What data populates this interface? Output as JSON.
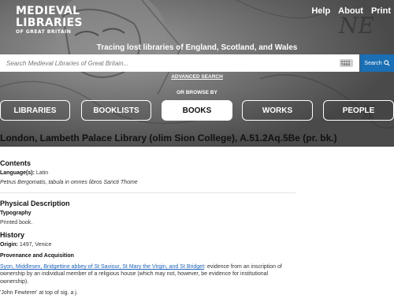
{
  "header": {
    "logo_line1": "MEDIEVAL",
    "logo_line2": "LIBRARIES",
    "logo_line3": "OF GREAT BRITAIN",
    "nav": [
      "Help",
      "About",
      "Print"
    ],
    "tagline": "Tracing lost libraries of England, Scotland, and Wales"
  },
  "search": {
    "placeholder": "Search Medieval Libraries of Great Britain...",
    "button_label": "Search",
    "advanced_label": "ADVANCED SEARCH",
    "browse_label": "OR BROWSE BY"
  },
  "browse": [
    {
      "label": "LIBRARIES",
      "active": false
    },
    {
      "label": "BOOKLISTS",
      "active": false
    },
    {
      "label": "BOOKS",
      "active": true
    },
    {
      "label": "WORKS",
      "active": false
    },
    {
      "label": "PEOPLE",
      "active": false
    }
  ],
  "record": {
    "title": "London, Lambeth Palace Library (olim Sion College), A.51.2Aq.5Be (pr. bk.)",
    "contents_heading": "Contents",
    "language_label": "Language(s):",
    "language_value": "Latin",
    "contents_text": "Petrus Bergomatis, tabula in omnes libros Sancti Thome",
    "physical_heading": "Physical Description",
    "typography_label": "Typography",
    "typography_value": "Printed book.",
    "history_heading": "History",
    "origin_label": "Origin:",
    "origin_value": "1497, Venice",
    "provenance_heading": "Provenance and Acquisition",
    "provenance_link": "Syon, Middlesex, Bridgettine abbey of St Saviour, St Mary the Virgin, and St Bridget",
    "provenance_text1": ": evidence from an inscription of",
    "provenance_text2": "ownership by an individual member of a religious house (which may not, however, be evidence for institutional",
    "provenance_text3": "ownership).",
    "inscription": "'John Fewterer' at top of sig. a j."
  }
}
